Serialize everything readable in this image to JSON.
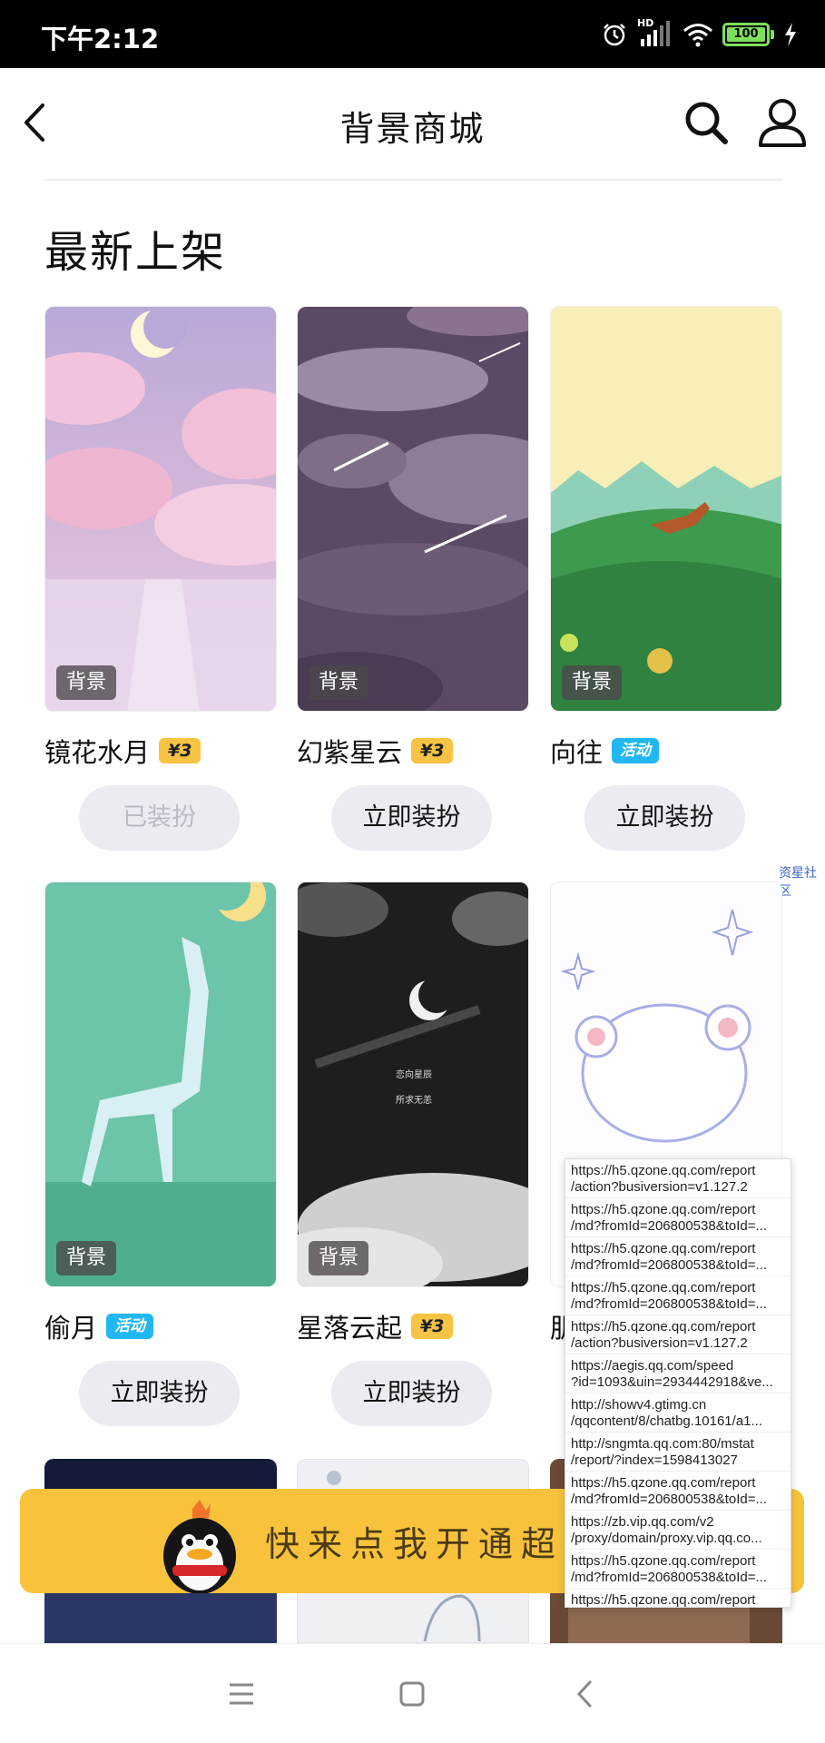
{
  "status_bar": {
    "time": "下午2:12",
    "hd_label": "HD",
    "battery": "100"
  },
  "header": {
    "title": "背景商城"
  },
  "section": {
    "title": "最新上架"
  },
  "tag_label": "背景",
  "cards": [
    {
      "name": "镜花水月",
      "badge": "¥3",
      "badge_type": "price",
      "action": "已装扮",
      "action_state": "disabled"
    },
    {
      "name": "幻紫星云",
      "badge": "¥3",
      "badge_type": "price",
      "action": "立即装扮",
      "action_state": "enabled"
    },
    {
      "name": "向往",
      "badge": "活动",
      "badge_type": "activity",
      "action": "立即装扮",
      "action_state": "enabled"
    },
    {
      "name": "偷月",
      "badge": "活动",
      "badge_type": "activity",
      "action": "立即装扮",
      "action_state": "enabled"
    },
    {
      "name": "星落云起",
      "badge": "¥3",
      "badge_type": "price",
      "action": "立即装扮",
      "action_state": "enabled"
    },
    {
      "name": "肌",
      "badge": "",
      "badge_type": "none",
      "action": "",
      "action_state": "hidden"
    }
  ],
  "card_images": {
    "card4_line1": "恋向星辰",
    "card4_line2": "所求无恙"
  },
  "side_link": "资星社区",
  "banner": {
    "text": "快来点我开通超级"
  },
  "url_popup": [
    [
      "https://h5.qzone.qq.com/report",
      "/action?busiversion=v1.127.2"
    ],
    [
      "https://h5.qzone.qq.com/report",
      "/md?fromId=206800538&toId=..."
    ],
    [
      "https://h5.qzone.qq.com/report",
      "/md?fromId=206800538&toId=..."
    ],
    [
      "https://h5.qzone.qq.com/report",
      "/md?fromId=206800538&toId=..."
    ],
    [
      "https://h5.qzone.qq.com/report",
      "/action?busiversion=v1.127.2"
    ],
    [
      "https://aegis.qq.com/speed",
      "?id=1093&uin=2934442918&ve..."
    ],
    [
      "http://showv4.gtimg.cn",
      "/qqcontent/8/chatbg.10161/a1..."
    ],
    [
      "http://sngmta.qq.com:80/mstat",
      "/report/?index=1598413027"
    ],
    [
      "https://h5.qzone.qq.com/report",
      "/md?fromId=206800538&toId=..."
    ],
    [
      "https://zb.vip.qq.com/v2",
      "/proxy/domain/proxy.vip.qq.co..."
    ],
    [
      "https://h5.qzone.qq.com/report",
      "/md?fromId=206800538&toId=..."
    ],
    [
      "https://h5.qzone.qq.com/report",
      ""
    ]
  ],
  "colors": {
    "price_badge": "#f6c343",
    "activity_badge": "#21b7f2",
    "banner": "#f8c23c",
    "button_bg": "#eaecf2"
  },
  "icons": {
    "back": "back-arrow-icon",
    "search": "search-icon",
    "profile": "profile-icon",
    "nav_menu": "menu-icon",
    "nav_home": "home-icon",
    "nav_back": "back-icon"
  }
}
